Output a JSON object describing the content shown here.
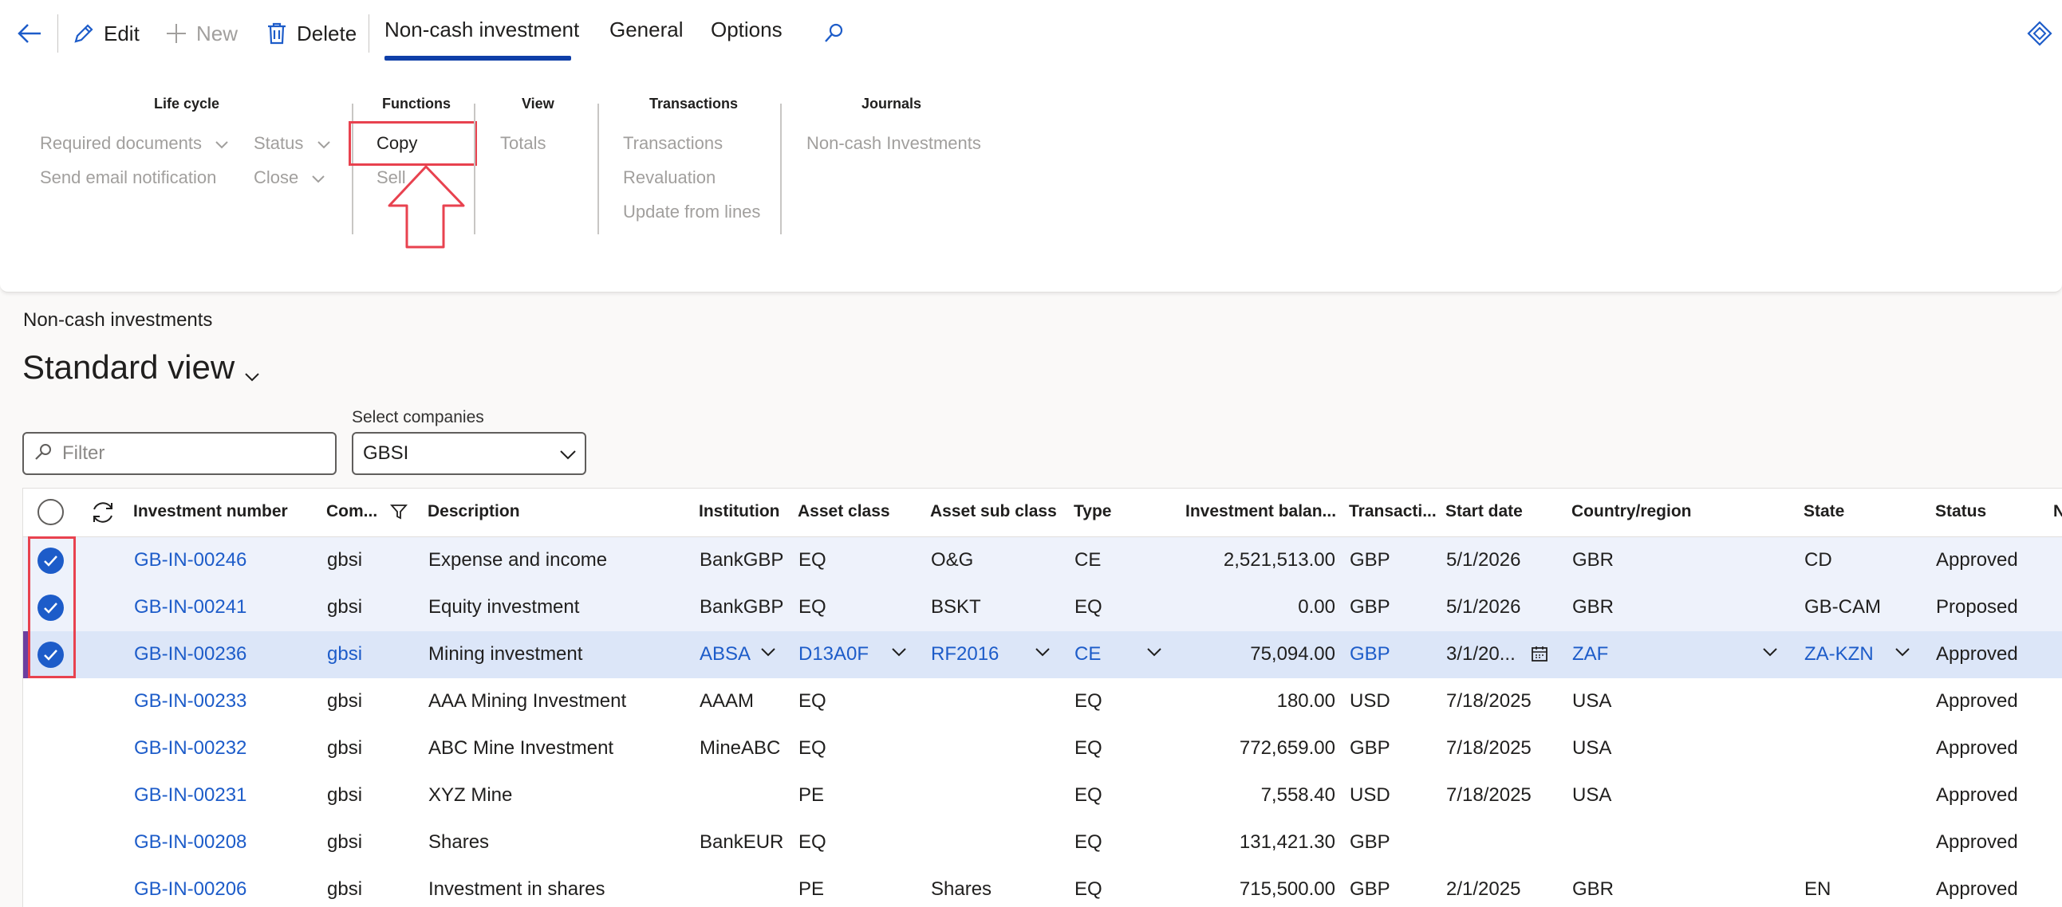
{
  "toolbar": {
    "back_label": "",
    "edit_label": "Edit",
    "new_label": "New",
    "delete_label": "Delete"
  },
  "tabs": [
    {
      "label": "Non-cash investment",
      "active": true
    },
    {
      "label": "General"
    },
    {
      "label": "Options"
    }
  ],
  "groups": {
    "lifecycle": {
      "title": "Life cycle",
      "items": [
        "Required documents",
        "Status",
        "Send email notification",
        "Close"
      ]
    },
    "functions": {
      "title": "Functions",
      "items": [
        "Copy",
        "Sell"
      ]
    },
    "view": {
      "title": "View",
      "items": [
        "Totals"
      ]
    },
    "transactions": {
      "title": "Transactions",
      "items": [
        "Transactions",
        "Revaluation",
        "Update from lines"
      ]
    },
    "journals": {
      "title": "Journals",
      "items": [
        "Non-cash Investments"
      ]
    }
  },
  "page": {
    "breadcrumb": "Non-cash investments",
    "view_title": "Standard view",
    "filter_placeholder": "Filter",
    "select_label": "Select companies",
    "select_value": "GBSI"
  },
  "grid": {
    "columns": [
      "Investment number",
      "Com...",
      "Description",
      "Institution",
      "Asset class",
      "Asset sub class",
      "Type",
      "Investment balan...",
      "Transacti...",
      "Start date",
      "Country/region",
      "State",
      "Status",
      "N"
    ],
    "rows": [
      {
        "inv": "GB-IN-00246",
        "com": "gbsi",
        "desc": "Expense and income",
        "inst": "BankGBP",
        "ac": "EQ",
        "asc": "O&G",
        "type": "CE",
        "bal": "2,521,513.00",
        "cur": "GBP",
        "start": "5/1/2026",
        "country": "GBR",
        "state": "CD",
        "status": "Approved"
      },
      {
        "inv": "GB-IN-00241",
        "com": "gbsi",
        "desc": "Equity investment",
        "inst": "BankGBP",
        "ac": "EQ",
        "asc": "BSKT",
        "type": "EQ",
        "bal": "0.00",
        "cur": "GBP",
        "start": "5/1/2026",
        "country": "GBR",
        "state": "GB-CAM",
        "status": "Proposed"
      },
      {
        "inv": "GB-IN-00236",
        "com": "gbsi",
        "desc": "Mining investment",
        "inst": "ABSA",
        "ac": "D13A0F",
        "asc": "RF2016",
        "type": "CE",
        "bal": "75,094.00",
        "cur": "GBP",
        "start": "3/1/20...",
        "country": "ZAF",
        "state": "ZA-KZN",
        "status": "Approved"
      },
      {
        "inv": "GB-IN-00233",
        "com": "gbsi",
        "desc": "AAA Mining Investment",
        "inst": "AAAM",
        "ac": "EQ",
        "asc": "",
        "type": "EQ",
        "bal": "180.00",
        "cur": "USD",
        "start": "7/18/2025",
        "country": "USA",
        "state": "",
        "status": "Approved"
      },
      {
        "inv": "GB-IN-00232",
        "com": "gbsi",
        "desc": "ABC Mine Investment",
        "inst": "MineABC",
        "ac": "EQ",
        "asc": "",
        "type": "EQ",
        "bal": "772,659.00",
        "cur": "GBP",
        "start": "7/18/2025",
        "country": "USA",
        "state": "",
        "status": "Approved"
      },
      {
        "inv": "GB-IN-00231",
        "com": "gbsi",
        "desc": "XYZ Mine",
        "inst": "",
        "ac": "PE",
        "asc": "",
        "type": "EQ",
        "bal": "7,558.40",
        "cur": "USD",
        "start": "7/18/2025",
        "country": "USA",
        "state": "",
        "status": "Approved"
      },
      {
        "inv": "GB-IN-00208",
        "com": "gbsi",
        "desc": "Shares",
        "inst": "BankEUR",
        "ac": "EQ",
        "asc": "",
        "type": "EQ",
        "bal": "131,421.30",
        "cur": "GBP",
        "start": "",
        "country": "",
        "state": "",
        "status": "Approved"
      },
      {
        "inv": "GB-IN-00206",
        "com": "gbsi",
        "desc": "Investment in shares",
        "inst": "",
        "ac": "PE",
        "asc": "Shares",
        "type": "EQ",
        "bal": "715,500.00",
        "cur": "GBP",
        "start": "2/1/2025",
        "country": "GBR",
        "state": "EN",
        "status": "Approved"
      }
    ]
  },
  "colors": {
    "accent": "#1d5cc9",
    "highlight": "#e8424f",
    "tab_underline": "#0f3fa8"
  }
}
